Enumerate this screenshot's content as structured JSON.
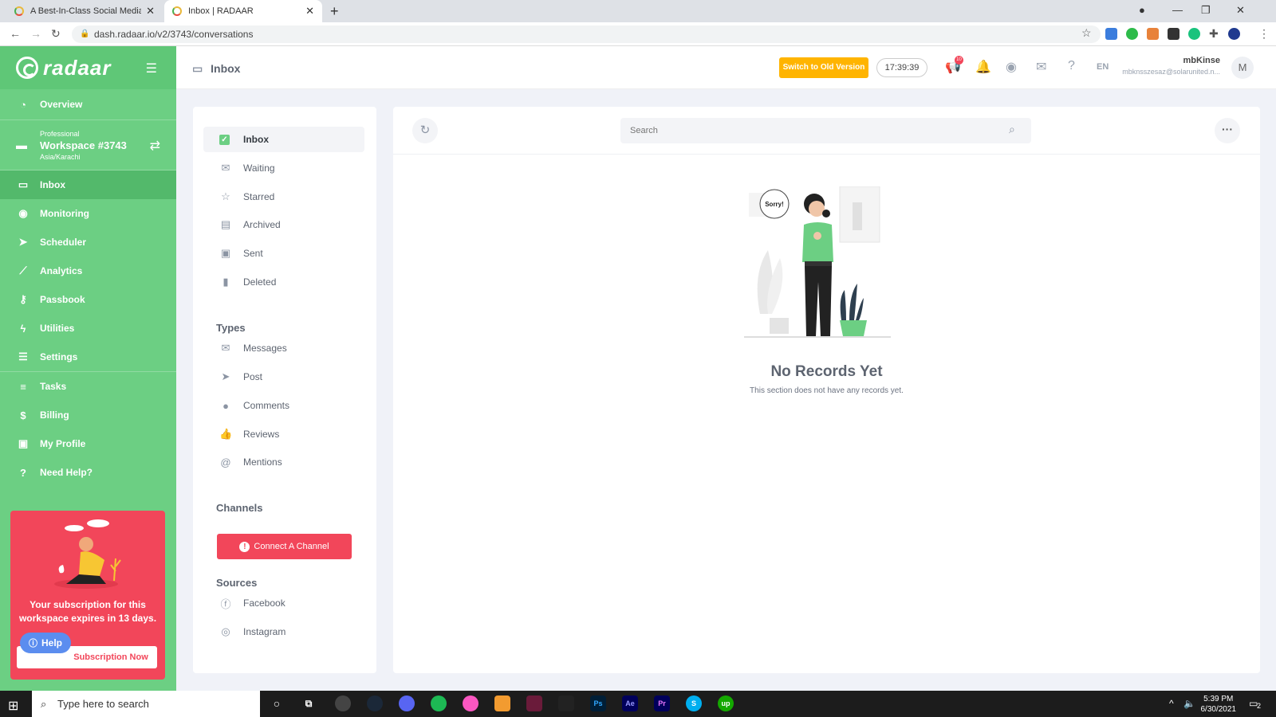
{
  "browser": {
    "tabs": [
      {
        "title": "A Best-In-Class Social Media Ma",
        "active": false
      },
      {
        "title": "Inbox | RADAAR",
        "active": true
      }
    ],
    "url": "dash.radaar.io/v2/3743/conversations"
  },
  "sidebar": {
    "logo": "radaar",
    "overview": "Overview",
    "workspace": {
      "plan": "Professional",
      "name": "Workspace #3743",
      "timezone": "Asia/Karachi"
    },
    "items": [
      {
        "label": "Inbox",
        "icon": "inbox-icon",
        "active": true
      },
      {
        "label": "Monitoring",
        "icon": "eye-icon"
      },
      {
        "label": "Scheduler",
        "icon": "paper-plane-icon"
      },
      {
        "label": "Analytics",
        "icon": "chart-icon"
      },
      {
        "label": "Passbook",
        "icon": "key-icon"
      },
      {
        "label": "Utilities",
        "icon": "bolt-icon"
      },
      {
        "label": "Settings",
        "icon": "sliders-icon"
      }
    ],
    "items2": [
      {
        "label": "Tasks",
        "icon": "list-icon"
      },
      {
        "label": "Billing",
        "icon": "dollar-icon"
      },
      {
        "label": "My Profile",
        "icon": "id-card-icon"
      },
      {
        "label": "Need Help?",
        "icon": "question-icon"
      }
    ],
    "promo": {
      "text": "Your subscription for this workspace expires in 13 days.",
      "button": "Subscription Now"
    },
    "help": "Help"
  },
  "topbar": {
    "title": "Inbox",
    "switch_button": "Switch to Old Version",
    "clock": "17:39:39",
    "notif_count": "10",
    "lang": "EN",
    "user_name": "mbKinse",
    "user_email": "mbknsszesaz@solarunited.n...",
    "avatar": "M"
  },
  "folders": {
    "items": [
      {
        "label": "Inbox",
        "icon": "check-icon"
      },
      {
        "label": "Waiting",
        "icon": "envelope-icon"
      },
      {
        "label": "Starred",
        "icon": "star-icon"
      },
      {
        "label": "Archived",
        "icon": "archive-icon"
      },
      {
        "label": "Sent",
        "icon": "sent-icon"
      },
      {
        "label": "Deleted",
        "icon": "trash-icon"
      }
    ],
    "types_heading": "Types",
    "types": [
      {
        "label": "Messages",
        "icon": "envelope-icon"
      },
      {
        "label": "Post",
        "icon": "paper-plane-icon"
      },
      {
        "label": "Comments",
        "icon": "comment-icon"
      },
      {
        "label": "Reviews",
        "icon": "thumbs-up-icon"
      },
      {
        "label": "Mentions",
        "icon": "at-icon"
      }
    ],
    "channels_heading": "Channels",
    "connect_button": "Connect A Channel",
    "sources_heading": "Sources",
    "sources": [
      {
        "label": "Facebook",
        "icon": "facebook-icon"
      },
      {
        "label": "Instagram",
        "icon": "instagram-icon"
      }
    ]
  },
  "main": {
    "search_placeholder": "Search",
    "bubble": "Sorry!",
    "empty_title": "No Records Yet",
    "empty_subtitle": "This section does not have any records yet."
  },
  "taskbar": {
    "search_placeholder": "Type here to search",
    "time": "5:39 PM",
    "date": "6/30/2021",
    "notif": "2"
  }
}
